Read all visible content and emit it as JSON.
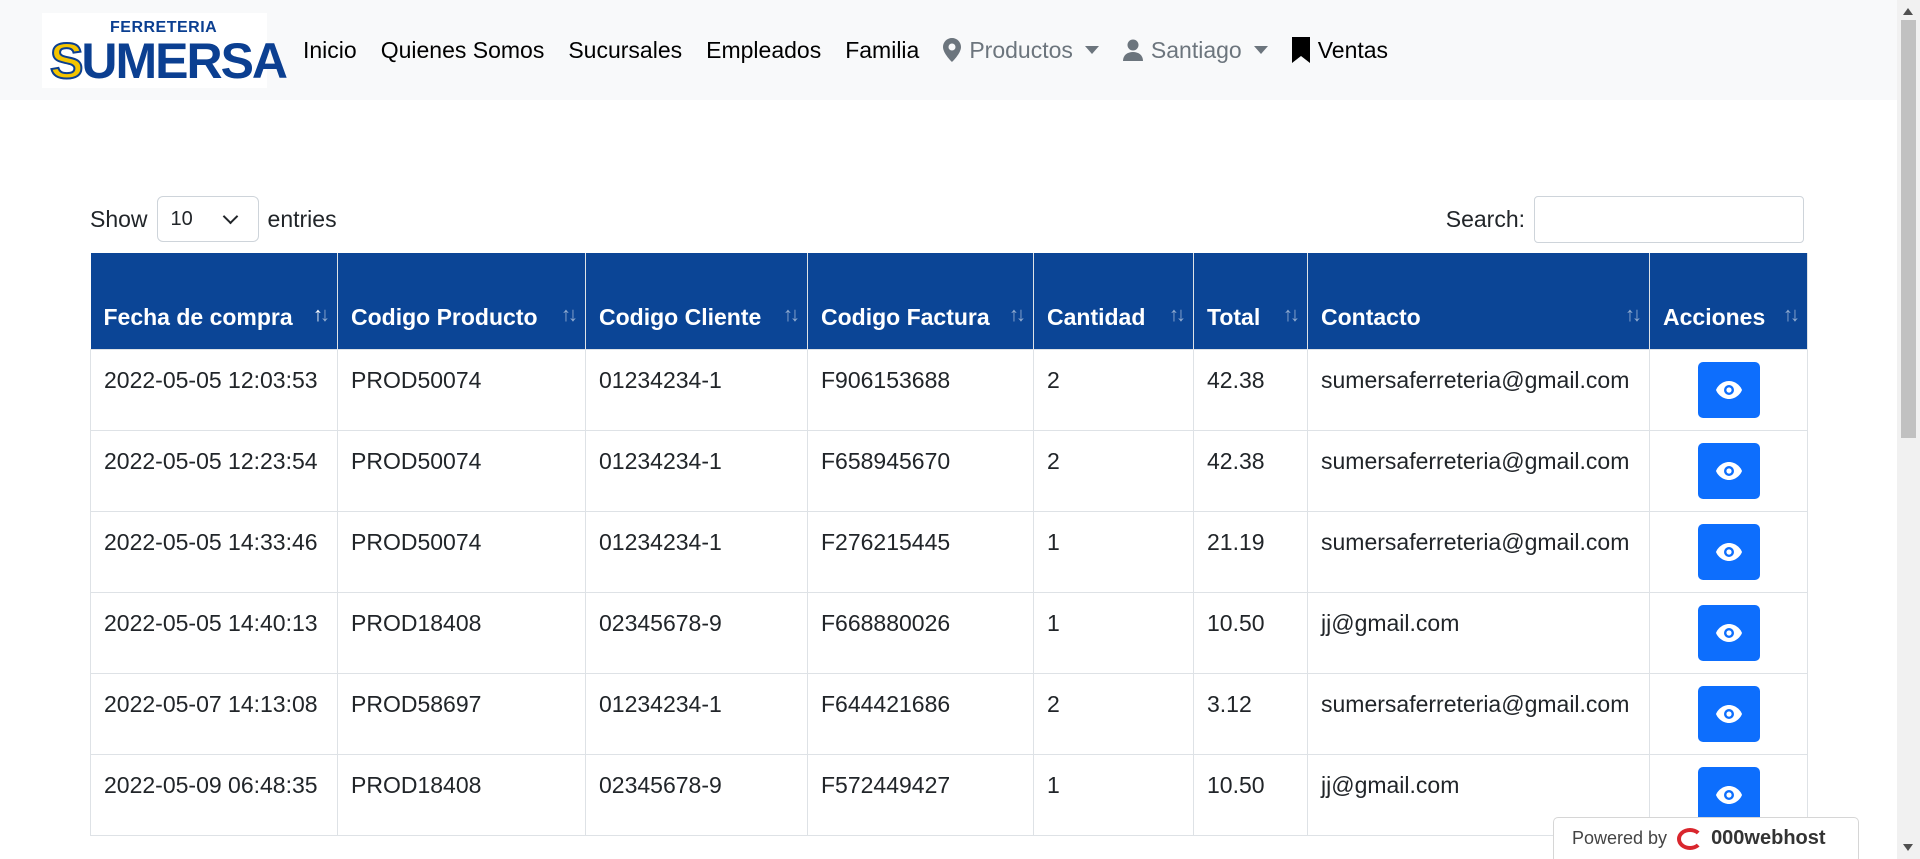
{
  "brand": {
    "top_line": "FERRETERIA",
    "name_first": "S",
    "name_rest": "UMERSA"
  },
  "nav": {
    "inicio": "Inicio",
    "quienes": "Quienes Somos",
    "sucursales": "Sucursales",
    "empleados": "Empleados",
    "familia": "Familia",
    "productos": "Productos",
    "usuario": "Santiago",
    "ventas": "Ventas"
  },
  "controls": {
    "show_label": "Show",
    "entries_value": "10",
    "entries_label": "entries",
    "search_label": "Search:",
    "search_value": ""
  },
  "table": {
    "headers": [
      "Fecha de compra",
      "Codigo Producto",
      "Codigo Cliente",
      "Codigo Factura",
      "Cantidad",
      "Total",
      "Contacto",
      "Acciones"
    ],
    "rows": [
      [
        "2022-05-05 12:03:53",
        "PROD50074",
        "01234234-1",
        "F906153688",
        "2",
        "42.38",
        "sumersaferreteria@gmail.com"
      ],
      [
        "2022-05-05 12:23:54",
        "PROD50074",
        "01234234-1",
        "F658945670",
        "2",
        "42.38",
        "sumersaferreteria@gmail.com"
      ],
      [
        "2022-05-05 14:33:46",
        "PROD50074",
        "01234234-1",
        "F276215445",
        "1",
        "21.19",
        "sumersaferreteria@gmail.com"
      ],
      [
        "2022-05-05 14:40:13",
        "PROD18408",
        "02345678-9",
        "F668880026",
        "1",
        "10.50",
        "jj@gmail.com"
      ],
      [
        "2022-05-07 14:13:08",
        "PROD58697",
        "01234234-1",
        "F644421686",
        "2",
        "3.12",
        "sumersaferreteria@gmail.com"
      ],
      [
        "2022-05-09 06:48:35",
        "PROD18408",
        "02345678-9",
        "F572449427",
        "1",
        "10.50",
        "jj@gmail.com"
      ]
    ]
  },
  "badge": {
    "powered_by": "Powered by",
    "host": "000webhost"
  },
  "colors": {
    "header_bg": "#0b4596",
    "button": "#0d6efd",
    "navbar_bg": "#f8f9fa"
  },
  "icons": {
    "nav_productos": "map-pin-icon",
    "nav_usuario": "user-icon",
    "nav_ventas": "bookmark-icon",
    "row_action": "eye-icon"
  }
}
